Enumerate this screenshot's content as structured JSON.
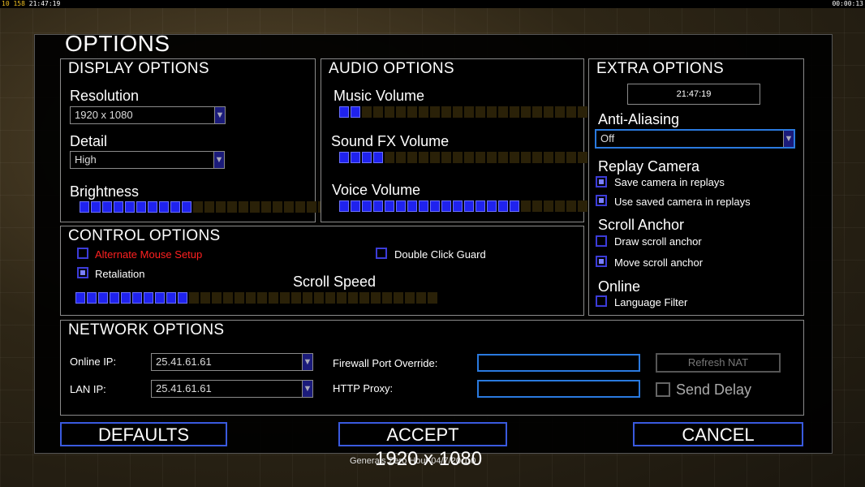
{
  "topbar": {
    "left_a": "10",
    "left_b": "158",
    "left_time": "21:47:19",
    "right_time": "00:00:13"
  },
  "title": "OPTIONS",
  "display": {
    "header": "DISPLAY OPTIONS",
    "resolution_label": "Resolution",
    "resolution_value": "1920 x 1080",
    "detail_label": "Detail",
    "detail_value": "High",
    "brightness_label": "Brightness",
    "brightness_level": 10,
    "brightness_total": 24
  },
  "audio": {
    "header": "AUDIO OPTIONS",
    "music_label": "Music Volume",
    "music_level": 2,
    "sfx_label": "Sound FX Volume",
    "sfx_level": 4,
    "voice_label": "Voice Volume",
    "voice_level": 16,
    "total": 24
  },
  "extra": {
    "header": "EXTRA OPTIONS",
    "clock": "21:47:19",
    "aa_label": "Anti-Aliasing",
    "aa_value": "Off",
    "replay_label": "Replay Camera",
    "save_camera": "Save camera in replays",
    "use_saved_camera": "Use saved camera in replays",
    "scroll_anchor_label": "Scroll Anchor",
    "draw_scroll_anchor": "Draw scroll anchor",
    "move_scroll_anchor": "Move scroll anchor",
    "online_label": "Online",
    "language_filter": "Language Filter"
  },
  "control": {
    "header": "CONTROL OPTIONS",
    "alt_mouse": "Alternate Mouse Setup",
    "double_click": "Double Click Guard",
    "retaliation": "Retaliation",
    "scroll_speed_label": "Scroll Speed",
    "scroll_level": 10,
    "scroll_total": 32
  },
  "network": {
    "header": "NETWORK OPTIONS",
    "online_ip_label": "Online IP:",
    "online_ip_value": "25.41.61.61",
    "lan_ip_label": "LAN IP:",
    "lan_ip_value": "25.41.61.61",
    "firewall_label": "Firewall Port Override:",
    "proxy_label": "HTTP Proxy:",
    "refresh_nat": "Refresh NAT",
    "send_delay": "Send Delay"
  },
  "buttons": {
    "defaults": "DEFAULTS",
    "accept": "ACCEPT",
    "cancel": "CANCEL"
  },
  "footer": {
    "version": "Generals Zero Hour 04/7/20 1.0",
    "resolution_overlay": "1920 x 1080"
  },
  "colors": {
    "accent": "#2a7adf",
    "slider_on": "#1f22ee",
    "slider_off": "#2a2108",
    "warning_text": "#ff2020"
  }
}
